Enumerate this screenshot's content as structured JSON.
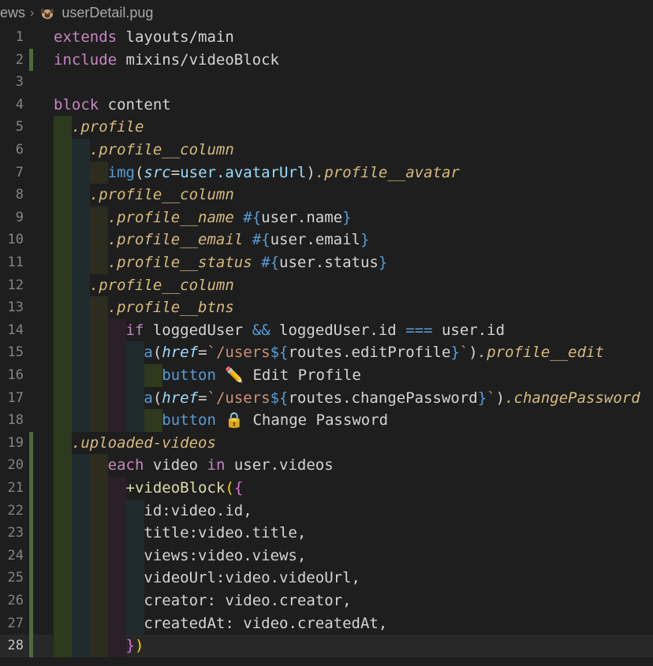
{
  "breadcrumb": {
    "folder": "iews",
    "file": "userDetail.pug"
  },
  "colors": {
    "editor_bg": "#1e1e1e",
    "current_line_bg": "#282828",
    "git_modified_bar": "#4d6b3c"
  },
  "icons": {
    "file_icon": "pug-dog-icon"
  },
  "editor": {
    "current_line": 28,
    "lines": [
      {
        "n": "1",
        "code": "extends layouts/main"
      },
      {
        "n": "2",
        "code": "include mixins/videoBlock"
      },
      {
        "n": "3",
        "code": ""
      },
      {
        "n": "4",
        "code": "block content"
      },
      {
        "n": "5",
        "code": "  .profile"
      },
      {
        "n": "6",
        "code": "    .profile__column"
      },
      {
        "n": "7",
        "code": "      img(src=user.avatarUrl).profile__avatar"
      },
      {
        "n": "8",
        "code": "    .profile__column"
      },
      {
        "n": "9",
        "code": "      .profile__name #{user.name}"
      },
      {
        "n": "10",
        "code": "      .profile__email #{user.email}"
      },
      {
        "n": "11",
        "code": "      .profile__status #{user.status}"
      },
      {
        "n": "12",
        "code": "    .profile__column"
      },
      {
        "n": "13",
        "code": "      .profile__btns"
      },
      {
        "n": "14",
        "code": "        if loggedUser && loggedUser.id === user.id"
      },
      {
        "n": "15",
        "code": "          a(href=`/users${routes.editProfile}`).profile__edit"
      },
      {
        "n": "16",
        "code": "            button ✏️ Edit Profile"
      },
      {
        "n": "17",
        "code": "          a(href=`/users${routes.changePassword}`).changePassword"
      },
      {
        "n": "18",
        "code": "            button 🔒 Change Password"
      },
      {
        "n": "19",
        "code": "  .uploaded-videos"
      },
      {
        "n": "20",
        "code": "      each video in user.videos"
      },
      {
        "n": "21",
        "code": "        +videoBlock({"
      },
      {
        "n": "22",
        "code": "          id:video.id,"
      },
      {
        "n": "23",
        "code": "          title:video.title,"
      },
      {
        "n": "24",
        "code": "          views:video.views,"
      },
      {
        "n": "25",
        "code": "          videoUrl:video.videoUrl,"
      },
      {
        "n": "26",
        "code": "          creator: video.creator,"
      },
      {
        "n": "27",
        "code": "          createdAt: video.createdAt,"
      },
      {
        "n": "28",
        "code": "        })"
      }
    ]
  }
}
